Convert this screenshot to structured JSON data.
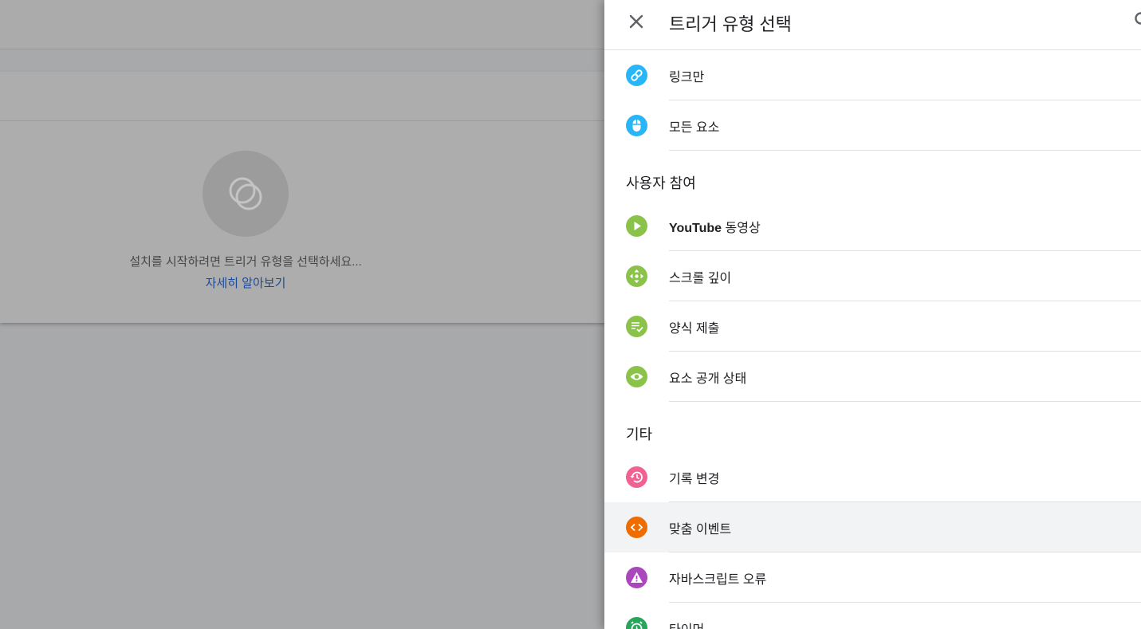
{
  "background": {
    "hint_text": "설치를 시작하려면 트리거 유형을 선택하세요...",
    "learn_more": "자세히 알아보기"
  },
  "panel": {
    "title": "트리거 유형 선택",
    "colors": {
      "blue": "#29b6f6",
      "green": "#8bc34a",
      "pink": "#f06292",
      "orange": "#ef6c00",
      "purple": "#ab47bc",
      "teal": "#26a65b"
    },
    "items_click": [
      {
        "label": "링크만",
        "icon": "link-icon"
      },
      {
        "label": "모든 요소",
        "icon": "mouse-icon"
      }
    ],
    "section_engagement": "사용자 참여",
    "items_engagement": [
      {
        "label_bold": "YouTube",
        "label": " 동영상",
        "icon": "play-icon"
      },
      {
        "label": "스크롤 깊이",
        "icon": "scroll-icon"
      },
      {
        "label": "양식 제출",
        "icon": "form-icon"
      },
      {
        "label": "요소 공개 상태",
        "icon": "eye-icon"
      }
    ],
    "section_other": "기타",
    "items_other": [
      {
        "label": "기록 변경",
        "icon": "history-icon"
      },
      {
        "label": "맞춤 이벤트",
        "icon": "code-icon"
      },
      {
        "label": "자바스크립트 오류",
        "icon": "warning-icon"
      },
      {
        "label": "타이머",
        "icon": "timer-icon"
      }
    ]
  }
}
